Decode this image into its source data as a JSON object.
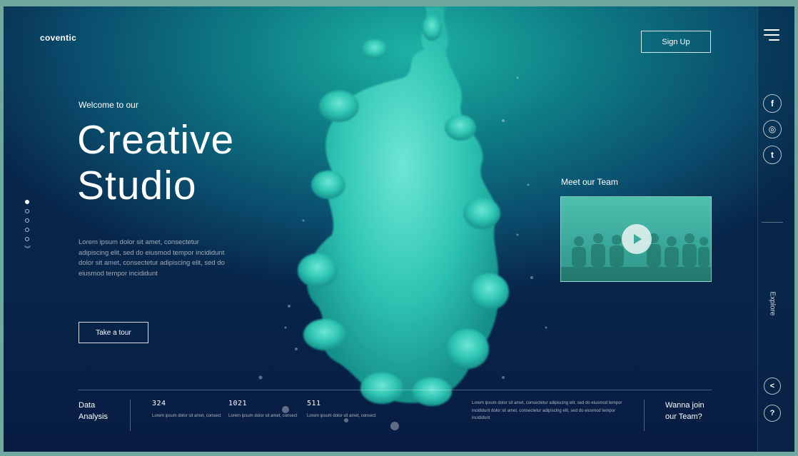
{
  "brand": "coventic",
  "header": {
    "signup_label": "Sign Up"
  },
  "hero": {
    "welcome": "Welcome to our",
    "title": "Creative\nStudio",
    "body": "Lorem ipsum dolor sit amet, consectetur adipiscing elit, sed do eiusmod tempor incididunt dolor sit amet, consectetur adipiscing elit, sed do eiusmod tempor incididunt",
    "tour_label": "Take a tour"
  },
  "team": {
    "heading": "Meet our Team"
  },
  "rail": {
    "explore": "Explore",
    "social": [
      {
        "icon": "facebook-icon",
        "glyph": "f"
      },
      {
        "icon": "instagram-icon",
        "glyph": "◎"
      },
      {
        "icon": "twitter-icon",
        "glyph": "t"
      }
    ],
    "share_glyph": "<",
    "help_glyph": "?"
  },
  "footer": {
    "data_label": "Data\nAnalysis",
    "stats": [
      {
        "value": "324",
        "desc": "Lorem ipsum dolor sit amet, consect"
      },
      {
        "value": "1021",
        "desc": "Lorem ipsum dolor sit amet, consect"
      },
      {
        "value": "511",
        "desc": "Lorem ipsum dolor sit amet, consect"
      }
    ],
    "paragraph": "Lorem ipsum dolor sit amet, consectetur adipiscing elit, sed do eiusmod tempor incididunt dolor sit amet, consectetur adipiscing elit, sed do eiusmod tempor incididunt",
    "join": "Wanna join\nour Team?"
  },
  "slider": {
    "dot_count": 5,
    "active_index": 0
  },
  "colors": {
    "accent": "#1db3a5",
    "deep": "#08254a",
    "teal_smoke": "#2fc6b3"
  }
}
